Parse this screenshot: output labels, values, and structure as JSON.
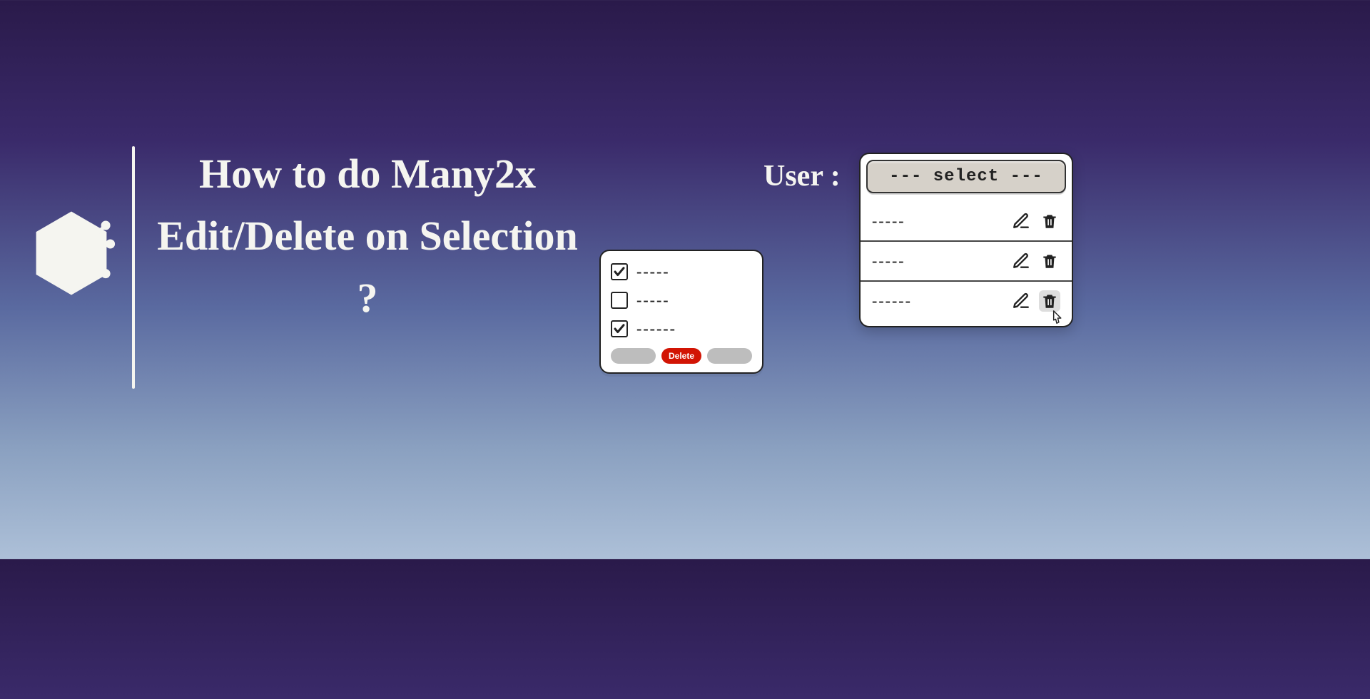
{
  "title": "How to do Many2x Edit/Delete on Selection ?",
  "user_label": "User :",
  "select_placeholder": "--- select ---",
  "checkbox_panel": {
    "rows": [
      {
        "checked": true,
        "text": "-----"
      },
      {
        "checked": false,
        "text": "-----"
      },
      {
        "checked": true,
        "text": "------"
      }
    ],
    "delete_label": "Delete"
  },
  "dropdown_panel": {
    "options": [
      {
        "text": "-----"
      },
      {
        "text": "-----"
      },
      {
        "text": "------"
      }
    ]
  },
  "icons": {
    "logo": "circuit-hex-icon",
    "edit": "edit-icon",
    "delete": "trash-icon",
    "cursor": "pointer-icon"
  }
}
